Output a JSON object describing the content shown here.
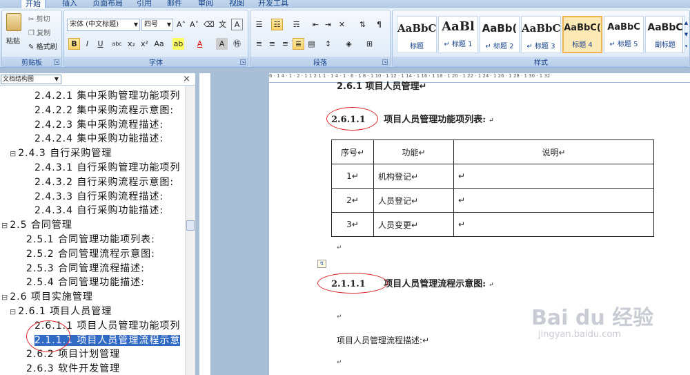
{
  "ribbon": {
    "tabs": [
      "开始",
      "插入",
      "页面布局",
      "引用",
      "邮件",
      "审阅",
      "视图",
      "开发工具"
    ],
    "clipboard": {
      "paste": "粘贴",
      "cut": "剪切",
      "copy": "复制",
      "format_painter": "格式刷",
      "label": "剪贴板"
    },
    "font": {
      "family": "宋体 (中文标题)",
      "size": "四号",
      "label": "字体"
    },
    "paragraph": {
      "label": "段落"
    },
    "styles": {
      "label": "样式",
      "items": [
        {
          "sample": "AaBbC",
          "name": "标题"
        },
        {
          "sample": "AaBl",
          "name": "↵ 标题 1"
        },
        {
          "sample": "AaBb(",
          "name": "↵ 标题 2"
        },
        {
          "sample": "AaBbC",
          "name": "↵ 标题 3"
        },
        {
          "sample": "AaBbC(",
          "name": "标题 4"
        },
        {
          "sample": "AaBbC",
          "name": "↵ 标题 5"
        },
        {
          "sample": "AaBbC",
          "name": "副标题"
        }
      ]
    }
  },
  "docmap": {
    "view": "文档结构图",
    "items": [
      {
        "text": "2.4.2.1 集中采购管理功能项列",
        "level": 3
      },
      {
        "text": "2.4.2.2 集中采购流程示意图:",
        "level": 3
      },
      {
        "text": "2.4.2.3 集中采购流程描述:",
        "level": 3
      },
      {
        "text": "2.4.2.4 集中采购功能描述:",
        "level": 3
      },
      {
        "text": "2.4.3 自行采购管理",
        "level": 1,
        "expander": "⊟"
      },
      {
        "text": "2.4.3.1 自行采购管理功能项列",
        "level": 3
      },
      {
        "text": "2.4.3.2 自行采购流程示意图:",
        "level": 3
      },
      {
        "text": "2.4.3.3 自行采购流程描述:",
        "level": 3
      },
      {
        "text": "2.4.3.4 自行采购功能描述:",
        "level": 3
      },
      {
        "text": "2.5 合同管理",
        "level": 0,
        "expander": "⊟"
      },
      {
        "text": "2.5.1 合同管理功能项列表:",
        "level": 2
      },
      {
        "text": "2.5.2 合同管理流程示意图:",
        "level": 2
      },
      {
        "text": "2.5.3 合同管理流程描述:",
        "level": 2
      },
      {
        "text": "2.5.4 合同管理功能描述:",
        "level": 2
      },
      {
        "text": "2.6 项目实施管理",
        "level": 0,
        "expander": "⊟"
      },
      {
        "text": "2.6.1 项目人员管理",
        "level": 1,
        "expander": "⊟"
      },
      {
        "text": "2.6.1.1 项目人员管理功能项列",
        "level": 3
      },
      {
        "text": "2.1.1.1 项目人员管理流程示意",
        "level": 3,
        "highlight": true
      },
      {
        "text": "2.6.2 项目计划管理",
        "level": 2
      },
      {
        "text": "2.6.3 软件开发管理",
        "level": 2
      }
    ]
  },
  "ruler": {
    "ticks": "6 · 1 4 · 1 · 2 · 1 1 2 1 1 · 1 4 · 1 · 6 · 1 8 · 1 10 · 1 12 · 1 14 · 1 16 · 1 18 · 1 20 · 1 22 · 1 24 · 1 26 · 1 28 · 1 30 · 1 32"
  },
  "document": {
    "top_cut": "2.6.1 项目人员管理↵",
    "heading1": {
      "num": "2.6.1.1",
      "title": "项目人员管理功能项列表:"
    },
    "table": {
      "headers": [
        "序号↵",
        "功能↵",
        "说明↵"
      ],
      "rows": [
        [
          "1↵",
          "机构登记↵",
          "↵"
        ],
        [
          "2↵",
          "人员登记↵",
          "↵"
        ],
        [
          "3↵",
          "人员变更↵",
          "↵"
        ]
      ]
    },
    "heading2": {
      "num": "2.1.1.1",
      "title": "项目人员管理流程示意图:"
    },
    "para_desc": "项目人员管理流程描述:↵",
    "pmark": "↵"
  },
  "watermark": {
    "brand": "Bai du 经验",
    "url": "jingyan.baidu.com"
  }
}
